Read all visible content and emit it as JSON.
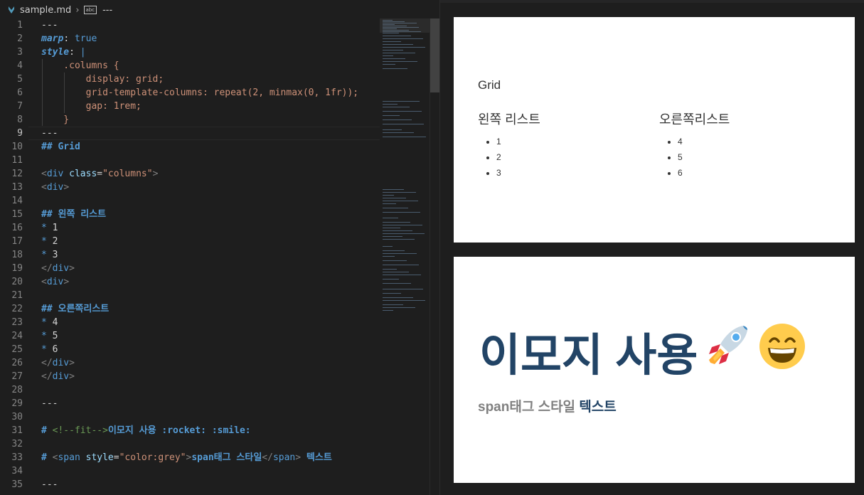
{
  "breadcrumb": {
    "file": "sample.md",
    "symbol_label": "abc",
    "more": "---"
  },
  "code_lines": [
    {
      "n": "1",
      "parts": [
        {
          "c": "c-white",
          "t": "---"
        }
      ]
    },
    {
      "n": "2",
      "parts": [
        {
          "c": "c-key",
          "t": "marp"
        },
        {
          "c": "c-white",
          "t": ": "
        },
        {
          "c": "c-kw",
          "t": "true"
        }
      ]
    },
    {
      "n": "3",
      "parts": [
        {
          "c": "c-key",
          "t": "style"
        },
        {
          "c": "c-white",
          "t": ": "
        },
        {
          "c": "c-kw",
          "t": "|"
        }
      ]
    },
    {
      "n": "4",
      "parts": [
        {
          "c": "c-orange",
          "t": "    .columns {"
        }
      ]
    },
    {
      "n": "5",
      "parts": [
        {
          "c": "c-orange",
          "t": "        display: grid;"
        }
      ]
    },
    {
      "n": "6",
      "parts": [
        {
          "c": "c-orange",
          "t": "        grid-template-columns: repeat(2, minmax(0, 1fr));"
        }
      ]
    },
    {
      "n": "7",
      "parts": [
        {
          "c": "c-orange",
          "t": "        gap: 1rem;"
        }
      ]
    },
    {
      "n": "8",
      "parts": [
        {
          "c": "c-orange",
          "t": "    }"
        }
      ]
    },
    {
      "n": "9",
      "parts": [
        {
          "c": "c-white",
          "t": "---"
        }
      ]
    },
    {
      "n": "10",
      "parts": [
        {
          "c": "c-h",
          "t": "## Grid"
        }
      ]
    },
    {
      "n": "11",
      "parts": []
    },
    {
      "n": "12",
      "parts": [
        {
          "c": "c-tag",
          "t": "<"
        },
        {
          "c": "c-tagname",
          "t": "div"
        },
        {
          "c": "c-white",
          "t": " "
        },
        {
          "c": "c-attr",
          "t": "class"
        },
        {
          "c": "c-white",
          "t": "="
        },
        {
          "c": "c-str",
          "t": "\"columns\""
        },
        {
          "c": "c-tag",
          "t": ">"
        }
      ]
    },
    {
      "n": "13",
      "parts": [
        {
          "c": "c-tag",
          "t": "<"
        },
        {
          "c": "c-tagname",
          "t": "div"
        },
        {
          "c": "c-tag",
          "t": ">"
        }
      ]
    },
    {
      "n": "14",
      "parts": []
    },
    {
      "n": "15",
      "parts": [
        {
          "c": "c-h",
          "t": "## 왼쪽 리스트"
        }
      ]
    },
    {
      "n": "16",
      "parts": [
        {
          "c": "c-sym",
          "t": "* "
        },
        {
          "c": "c-white",
          "t": "1"
        }
      ]
    },
    {
      "n": "17",
      "parts": [
        {
          "c": "c-sym",
          "t": "* "
        },
        {
          "c": "c-white",
          "t": "2"
        }
      ]
    },
    {
      "n": "18",
      "parts": [
        {
          "c": "c-sym",
          "t": "* "
        },
        {
          "c": "c-white",
          "t": "3"
        }
      ]
    },
    {
      "n": "19",
      "parts": [
        {
          "c": "c-tag",
          "t": "</"
        },
        {
          "c": "c-tagname",
          "t": "div"
        },
        {
          "c": "c-tag",
          "t": ">"
        }
      ]
    },
    {
      "n": "20",
      "parts": [
        {
          "c": "c-tag",
          "t": "<"
        },
        {
          "c": "c-tagname",
          "t": "div"
        },
        {
          "c": "c-tag",
          "t": ">"
        }
      ]
    },
    {
      "n": "21",
      "parts": []
    },
    {
      "n": "22",
      "parts": [
        {
          "c": "c-h",
          "t": "## 오른쪽리스트"
        }
      ]
    },
    {
      "n": "23",
      "parts": [
        {
          "c": "c-sym",
          "t": "* "
        },
        {
          "c": "c-white",
          "t": "4"
        }
      ]
    },
    {
      "n": "24",
      "parts": [
        {
          "c": "c-sym",
          "t": "* "
        },
        {
          "c": "c-white",
          "t": "5"
        }
      ]
    },
    {
      "n": "25",
      "parts": [
        {
          "c": "c-sym",
          "t": "* "
        },
        {
          "c": "c-white",
          "t": "6"
        }
      ]
    },
    {
      "n": "26",
      "parts": [
        {
          "c": "c-tag",
          "t": "</"
        },
        {
          "c": "c-tagname",
          "t": "div"
        },
        {
          "c": "c-tag",
          "t": ">"
        }
      ]
    },
    {
      "n": "27",
      "parts": [
        {
          "c": "c-tag",
          "t": "</"
        },
        {
          "c": "c-tagname",
          "t": "div"
        },
        {
          "c": "c-tag",
          "t": ">"
        }
      ]
    },
    {
      "n": "28",
      "parts": []
    },
    {
      "n": "29",
      "parts": [
        {
          "c": "c-white",
          "t": "---"
        }
      ]
    },
    {
      "n": "30",
      "parts": []
    },
    {
      "n": "31",
      "parts": [
        {
          "c": "c-h",
          "t": "# "
        },
        {
          "c": "c-comment",
          "t": "<!--fit-->"
        },
        {
          "c": "c-h",
          "t": "이모지 사용 :rocket: :smile:"
        }
      ]
    },
    {
      "n": "32",
      "parts": []
    },
    {
      "n": "33",
      "parts": [
        {
          "c": "c-h",
          "t": "# "
        },
        {
          "c": "c-tag",
          "t": "<"
        },
        {
          "c": "c-tagname",
          "t": "span"
        },
        {
          "c": "c-white",
          "t": " "
        },
        {
          "c": "c-attr",
          "t": "style"
        },
        {
          "c": "c-white",
          "t": "="
        },
        {
          "c": "c-str",
          "t": "\"color:grey\""
        },
        {
          "c": "c-tag",
          "t": ">"
        },
        {
          "c": "c-h",
          "t": "span태그 스타일"
        },
        {
          "c": "c-tag",
          "t": "</"
        },
        {
          "c": "c-tagname",
          "t": "span"
        },
        {
          "c": "c-tag",
          "t": ">"
        },
        {
          "c": "c-h",
          "t": " 텍스트"
        }
      ]
    },
    {
      "n": "34",
      "parts": []
    },
    {
      "n": "35",
      "parts": [
        {
          "c": "c-white",
          "t": "---"
        }
      ]
    }
  ],
  "active_line": "9",
  "slide1": {
    "title": "Grid",
    "left": {
      "heading": "왼쪽 리스트",
      "items": [
        "1",
        "2",
        "3"
      ]
    },
    "right": {
      "heading": "오른쪽리스트",
      "items": [
        "4",
        "5",
        "6"
      ]
    }
  },
  "slide2": {
    "title": "이모지 사용",
    "emojis": [
      "rocket-icon",
      "smile-icon"
    ],
    "subtitle_grey": "span태그 스타일",
    "subtitle_rest": "텍스트"
  },
  "colors": {
    "editor_bg": "#1e1e1e",
    "slide_title": "#224466",
    "grey_span": "#808080"
  }
}
